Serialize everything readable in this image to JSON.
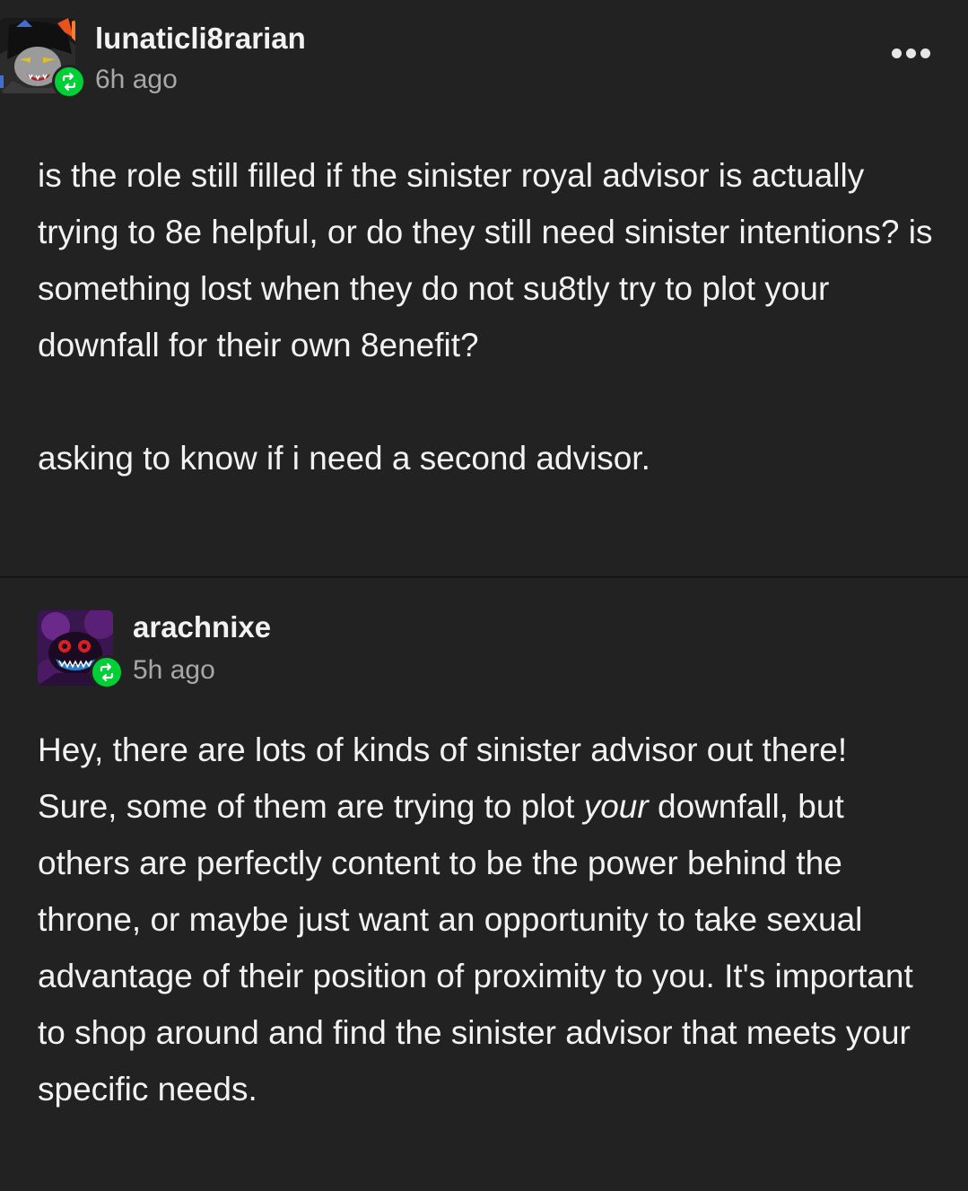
{
  "post1": {
    "username": "lunaticli8rarian",
    "timestamp": "6h ago",
    "avatar_icon": "troll-character-avatar-icon",
    "reblog_icon": "reblog-icon",
    "menu_icon": "more-options-icon",
    "paragraph1": "is the role still filled if the sinister royal advisor is actually trying to 8e helpful, or do they still need sinister intentions? is something lost when they do not su8tly try to plot your downfall for their own 8enefit?",
    "paragraph2": "asking to know if i need a second advisor."
  },
  "post2": {
    "username": "arachnixe",
    "timestamp": "5h ago",
    "avatar_icon": "purple-spider-avatar-icon",
    "reblog_icon": "reblog-icon",
    "text_before_italic": "Hey, there are lots of kinds of sinister advisor out there! Sure, some of them are trying to plot ",
    "italic_word": "your",
    "text_after_italic": " downfall, but others are perfectly content to be the power behind the throne, or maybe just want an opportunity to take sexual advantage of their position of proximity to you. It's important to shop around and find the sinister advisor that meets your specific needs."
  },
  "colors": {
    "background": "#222222",
    "text": "#f2f2f2",
    "muted": "#a8a8a8",
    "reblog_green": "#00cf35"
  }
}
